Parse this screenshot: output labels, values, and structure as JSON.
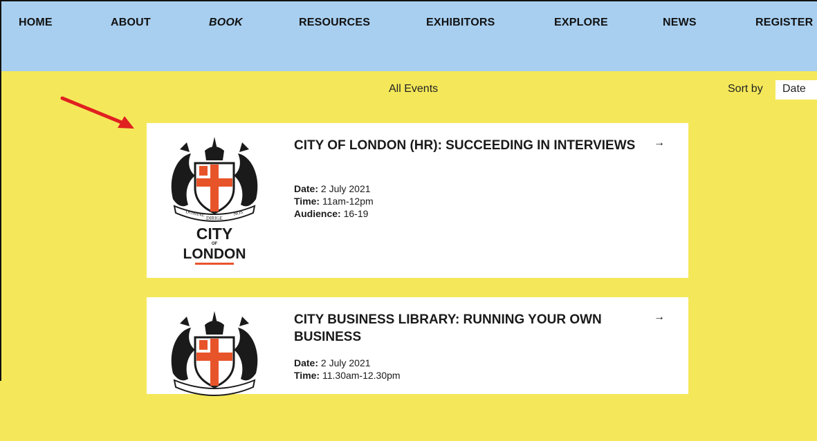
{
  "nav": {
    "items": [
      {
        "label": "HOME"
      },
      {
        "label": "ABOUT"
      },
      {
        "label": "BOOK"
      },
      {
        "label": "RESOURCES"
      },
      {
        "label": "EXHIBITORS"
      },
      {
        "label": "EXPLORE"
      },
      {
        "label": "NEWS"
      },
      {
        "label": "REGISTER"
      }
    ],
    "active": "BOOK"
  },
  "filter": {
    "heading": "All Events",
    "sort_label": "Sort by",
    "sort_value": "Date"
  },
  "events": [
    {
      "title": "CITY OF LONDON (HR): SUCCEEDING IN INTERVIEWS",
      "date_label": "Date:",
      "date": "2 July 2021",
      "time_label": "Time:",
      "time": "11am-12pm",
      "audience_label": "Audience:",
      "audience": "16-19",
      "logo": {
        "motto_left": "DOMINE",
        "motto_mid": "DIRIGE",
        "motto_right": "NOS",
        "line1": "CITY",
        "line2": "OF",
        "line3": "LONDON"
      },
      "arrow": "→"
    },
    {
      "title": "CITY BUSINESS LIBRARY: RUNNING YOUR OWN BUSINESS",
      "date_label": "Date:",
      "date": "2 July 2021",
      "time_label": "Time:",
      "time": "11.30am-12.30pm",
      "arrow": "→"
    }
  ],
  "colors": {
    "nav_bg": "#a8cff0",
    "page_bg": "#f4e85a",
    "annotation": "#e02020",
    "cross": "#e8542a"
  }
}
